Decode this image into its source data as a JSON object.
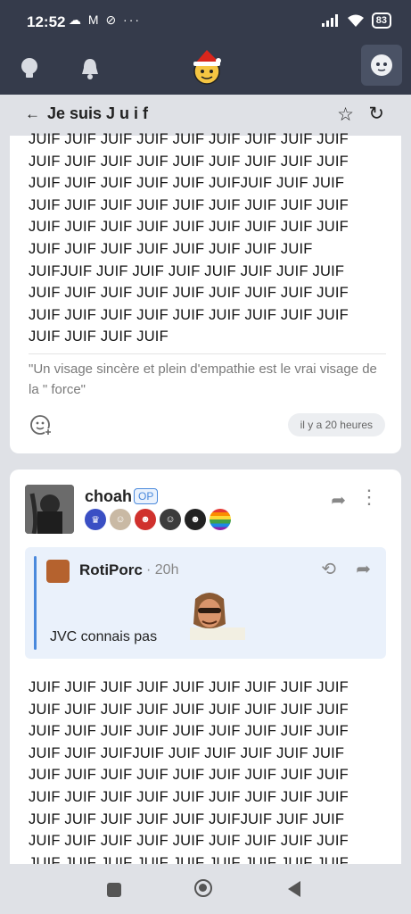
{
  "status": {
    "time": "12:52",
    "notifications": "☁ M ⊘ ···",
    "battery": "83"
  },
  "topic": {
    "title": "Je suis J u i f"
  },
  "post1": {
    "text": "JUIF JUIF JUIF JUIF JUIF JUIF JUIF JUIF JUIF\nJUIF JUIF JUIF JUIF JUIF JUIF JUIF JUIF JUIF\nJUIF JUIF JUIF JUIF JUIF JUIFJUIF JUIF JUIF\nJUIF JUIF JUIF JUIF JUIF JUIF JUIF JUIF JUIF\nJUIF JUIF JUIF JUIF JUIF JUIF JUIF JUIF JUIF\nJUIF JUIF JUIF JUIF JUIF JUIF JUIF JUIF\nJUIFJUIF JUIF JUIF JUIF JUIF JUIF JUIF JUIF\nJUIF JUIF JUIF JUIF JUIF JUIF JUIF JUIF JUIF\nJUIF JUIF JUIF JUIF JUIF JUIF JUIF JUIF JUIF\nJUIF JUIF JUIF JUIF",
    "signature": "\"Un visage sincère et plein d'empathie est le vrai visage de la \" force\"",
    "time": "il y a 20 heures"
  },
  "post2": {
    "username": "choah",
    "op_label": "OP",
    "quote": {
      "username": "RotiPorc",
      "time": "· 20h",
      "text": "JVC connais pas"
    },
    "text": "JUIF JUIF JUIF JUIF JUIF JUIF JUIF JUIF JUIF\nJUIF JUIF JUIF JUIF JUIF JUIF JUIF JUIF JUIF\nJUIF JUIF JUIF JUIF JUIF JUIF JUIF JUIF JUIF\nJUIF JUIF JUIFJUIF JUIF JUIF JUIF JUIF JUIF\nJUIF JUIF JUIF JUIF JUIF JUIF JUIF JUIF JUIF\nJUIF JUIF JUIF JUIF JUIF JUIF JUIF JUIF JUIF\nJUIF JUIF JUIF JUIF JUIF JUIFJUIF JUIF JUIF\nJUIF JUIF JUIF JUIF JUIF JUIF JUIF JUIF JUIF\nJUIF JUIF JUIF JUIF JUIF JUIF JUIF JUIF JUIF"
  },
  "colors": {
    "header": "#353b4b",
    "accent": "#4a89dc",
    "background": "#dfe1e6"
  }
}
